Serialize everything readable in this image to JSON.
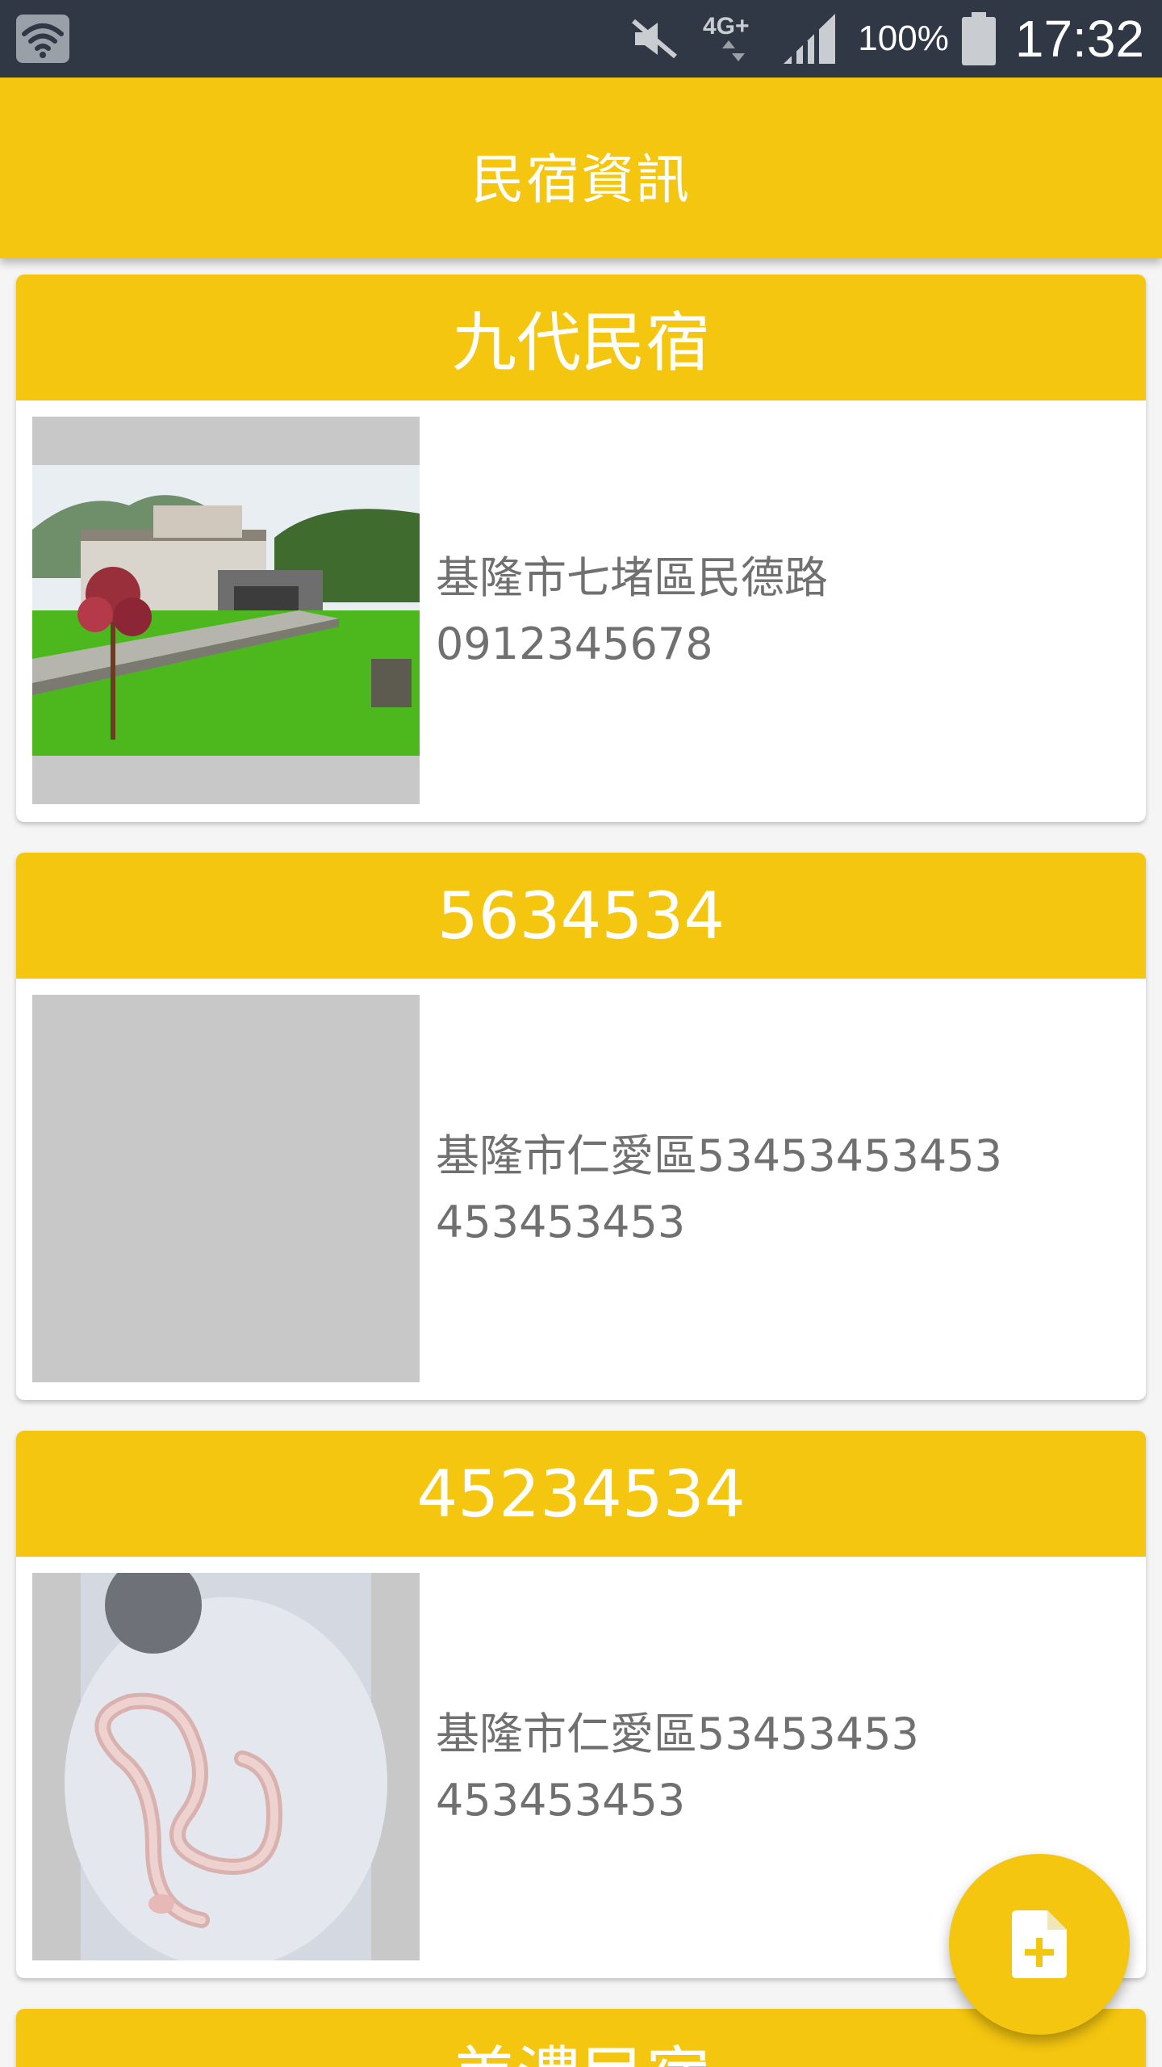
{
  "status_bar": {
    "network": "4G+",
    "battery": "100%",
    "time": "17:32"
  },
  "app_bar": {
    "title": "民宿資訊"
  },
  "cards": [
    {
      "name": "九代民宿",
      "address": "基隆市七堵區民德路",
      "phone": "0912345678",
      "image": "house-photo"
    },
    {
      "name": "5634534",
      "address": "基隆市仁愛區53453453453",
      "phone": "453453453",
      "image": "empty-placeholder"
    },
    {
      "name": "45234534",
      "address": "基隆市仁愛區53453453",
      "phone": "453453453",
      "image": "snake-photo"
    },
    {
      "name": "美濃民宿"
    }
  ],
  "fab": {
    "icon": "add-file-icon"
  },
  "colors": {
    "accent": "#f5c60f",
    "status_bar": "#303846",
    "text_secondary": "#707070",
    "placeholder": "#c8c8c8"
  }
}
